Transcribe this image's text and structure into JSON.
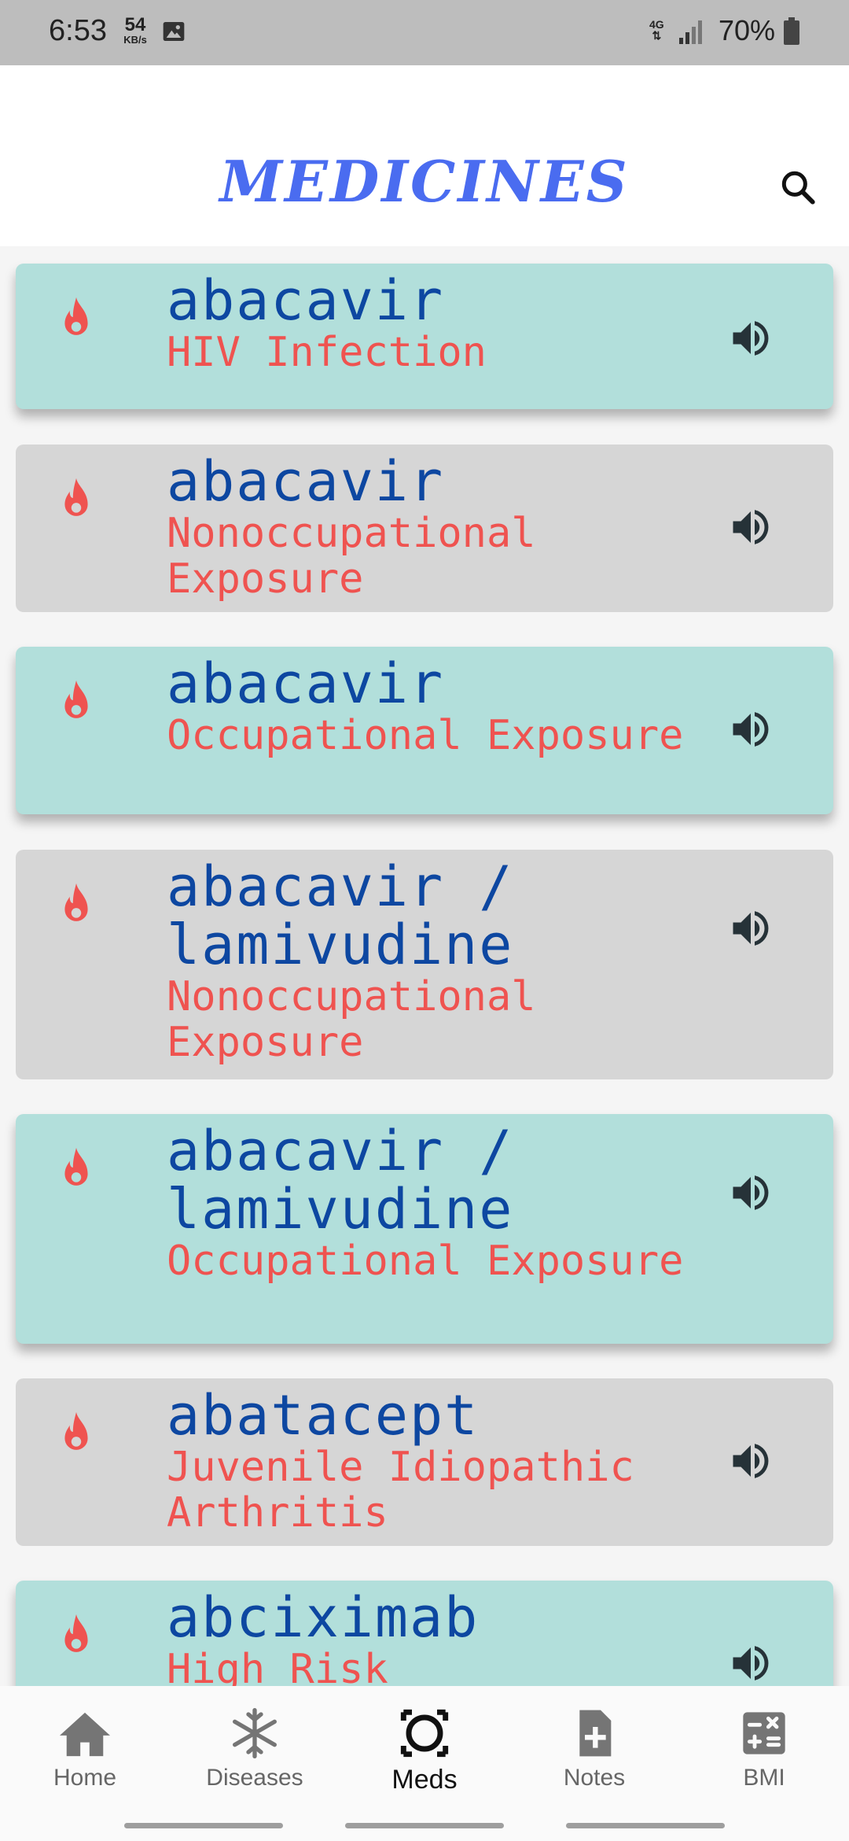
{
  "status_bar": {
    "time": "6:53",
    "speed_value": "54",
    "speed_unit": "KB/s",
    "network": "4G",
    "battery": "70%"
  },
  "header": {
    "title": "MEDICINES",
    "search_icon": "search-icon"
  },
  "medicines": [
    {
      "name": "abacavir",
      "condition": "HIV Infection"
    },
    {
      "name": "abacavir",
      "condition": "Nonoccupational Exposure"
    },
    {
      "name": "abacavir",
      "condition": "Occupational Exposure"
    },
    {
      "name": "abacavir / lamivudine",
      "condition": "Nonoccupational Exposure"
    },
    {
      "name": "abacavir / lamivudine",
      "condition": "Occupational Exposure"
    },
    {
      "name": "abatacept",
      "condition": "Juvenile Idiopathic Arthritis"
    },
    {
      "name": "abciximab",
      "condition": "High Risk"
    }
  ],
  "bottom_nav": [
    {
      "label": "Home",
      "icon": "home-icon"
    },
    {
      "label": "Diseases",
      "icon": "snowflake-icon"
    },
    {
      "label": "Meds",
      "icon": "meds-icon",
      "active": true
    },
    {
      "label": "Notes",
      "icon": "note-add-icon"
    },
    {
      "label": "BMI",
      "icon": "calculator-icon"
    }
  ],
  "colors": {
    "title": "#4a6cf0",
    "card_teal": "#b2dfdb",
    "card_grey": "#d6d6d6",
    "drug_name": "#0d47a1",
    "condition": "#ef5350"
  }
}
